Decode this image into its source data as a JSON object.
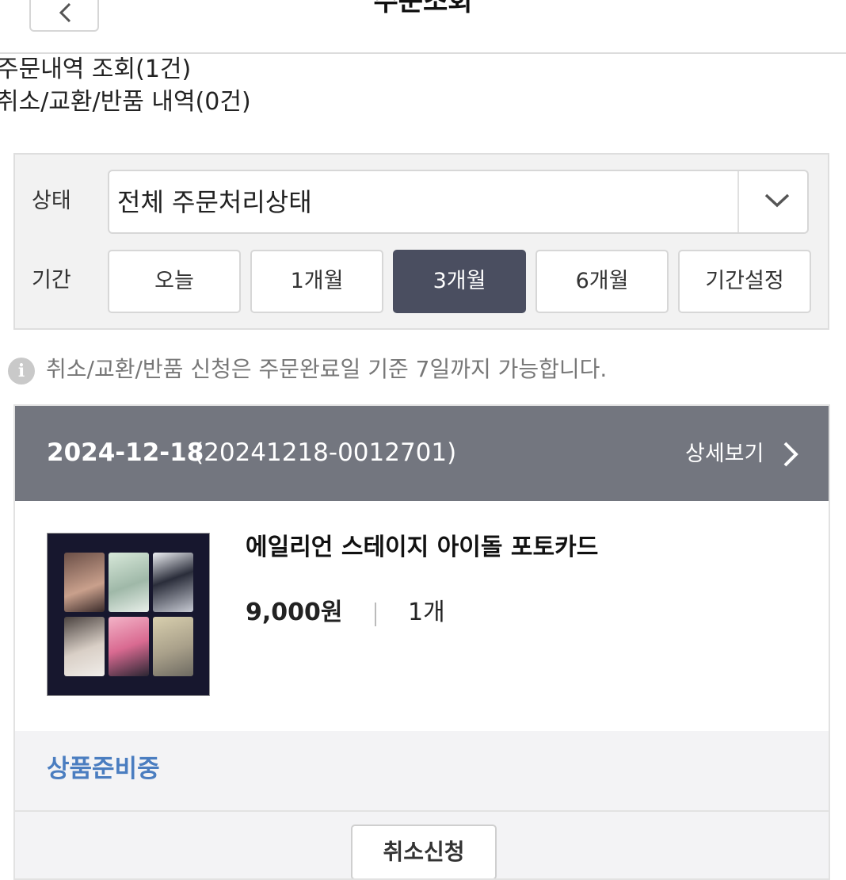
{
  "header": {
    "title": "주문조회",
    "back_icon": "chevron-left-icon"
  },
  "tabs": {
    "orders": "주문내역 조회(1건)",
    "returns": "취소/교환/반품 내역(0건)"
  },
  "filter": {
    "status_label": "상태",
    "status_value": "전체 주문처리상태",
    "period_label": "기간",
    "periods": [
      "오늘",
      "1개월",
      "3개월",
      "6개월",
      "기간설정"
    ],
    "active_period": "3개월"
  },
  "notice": {
    "icon": "info-icon",
    "icon_glyph": "i",
    "text": "취소/교환/반품 신청은 주문완료일 기준 7일까지 가능합니다."
  },
  "order": {
    "date": "2024-12-18",
    "order_number": "(20241218-0012701)",
    "detail_label": "상세보기",
    "product_name": "에일리언 스테이지 아이돌 포토카드",
    "price": "9,000원",
    "quantity": "1개",
    "status": "상품준비중",
    "cancel_label": "취소신청"
  },
  "colors": {
    "active_period_bg": "#4a4e60",
    "order_header_bg": "#73767f",
    "status_text": "#4a7dc0"
  }
}
